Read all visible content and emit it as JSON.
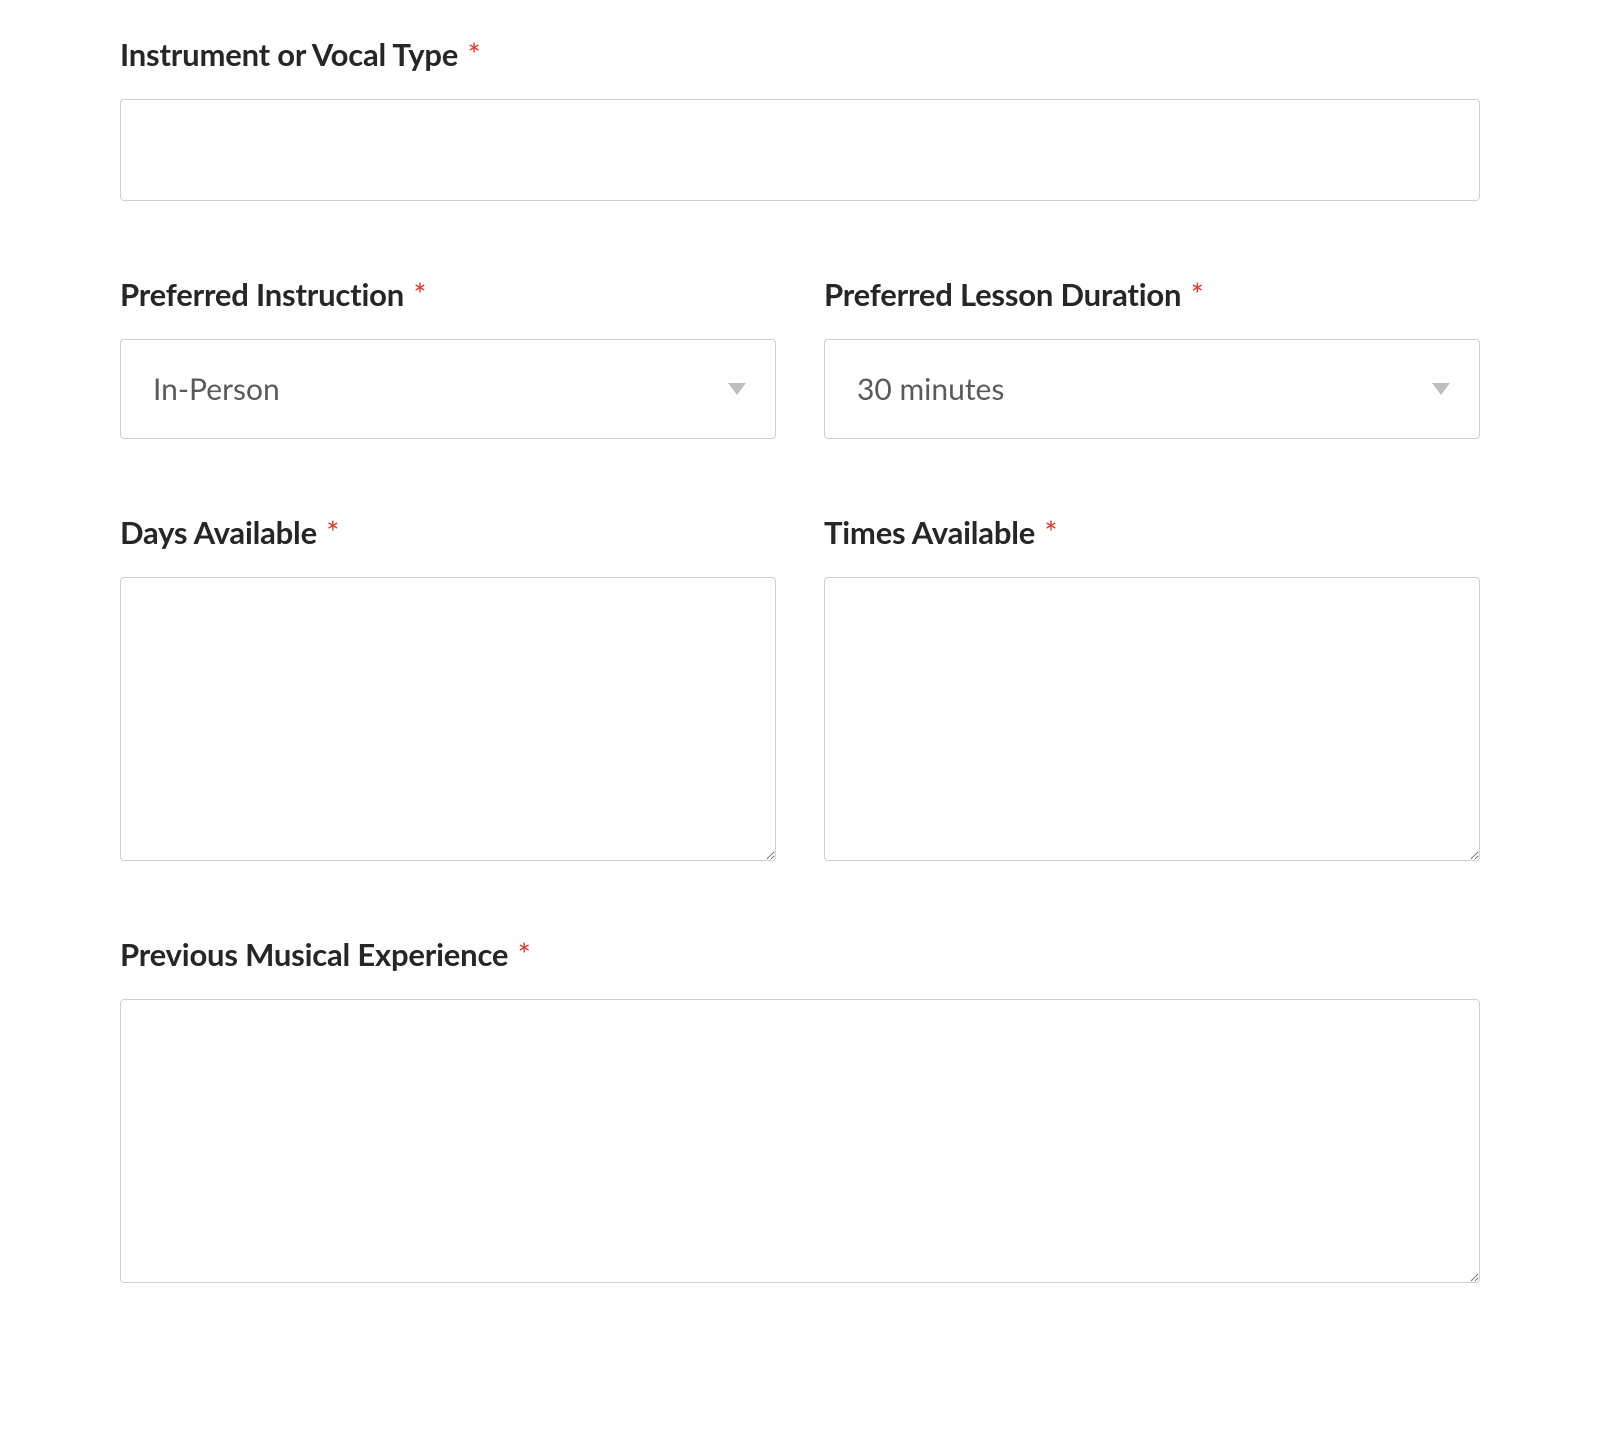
{
  "fields": {
    "instrument": {
      "label": "Instrument or Vocal Type",
      "required": "*",
      "value": ""
    },
    "instruction": {
      "label": "Preferred Instruction",
      "required": "*",
      "selected": "In-Person"
    },
    "duration": {
      "label": "Preferred Lesson Duration",
      "required": "*",
      "selected": "30 minutes"
    },
    "days": {
      "label": "Days Available",
      "required": "*",
      "value": ""
    },
    "times": {
      "label": "Times Available",
      "required": "*",
      "value": ""
    },
    "experience": {
      "label": "Previous Musical Experience",
      "required": "*",
      "value": ""
    }
  }
}
